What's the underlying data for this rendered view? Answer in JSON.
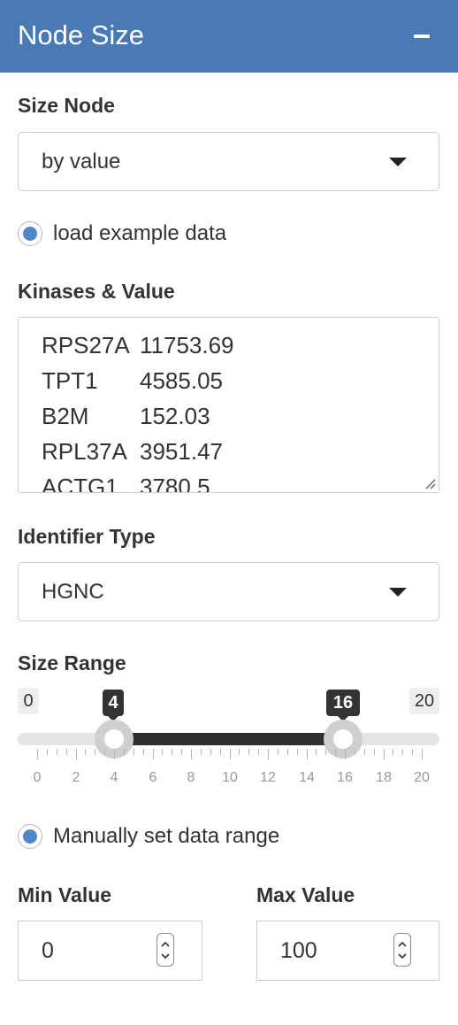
{
  "panel": {
    "title": "Node Size",
    "collapse_icon": "minus-icon",
    "accent_color": "#4a7ab3"
  },
  "size_node": {
    "label": "Size Node",
    "selected": "by value"
  },
  "example_data_radio": {
    "label": "load example data",
    "checked": true
  },
  "kinases": {
    "label": "Kinases & Value",
    "rows": [
      {
        "name": "RPS27A",
        "value": "11753.69"
      },
      {
        "name": "TPT1",
        "value": "4585.05"
      },
      {
        "name": "B2M",
        "value": "152.03"
      },
      {
        "name": "RPL37A",
        "value": "3951.47"
      },
      {
        "name": "ACTG1",
        "value": "3780.5"
      }
    ]
  },
  "identifier_type": {
    "label": "Identifier Type",
    "selected": "HGNC"
  },
  "size_range": {
    "label": "Size Range",
    "min": "0",
    "max": "20",
    "low": "4",
    "high": "16",
    "ticks": [
      "0",
      "2",
      "4",
      "6",
      "8",
      "10",
      "12",
      "14",
      "16",
      "18",
      "20"
    ]
  },
  "manual_range_radio": {
    "label": "Manually set data range",
    "checked": true
  },
  "min_value": {
    "label": "Min Value",
    "value": "0"
  },
  "max_value": {
    "label": "Max Value",
    "value": "100"
  }
}
